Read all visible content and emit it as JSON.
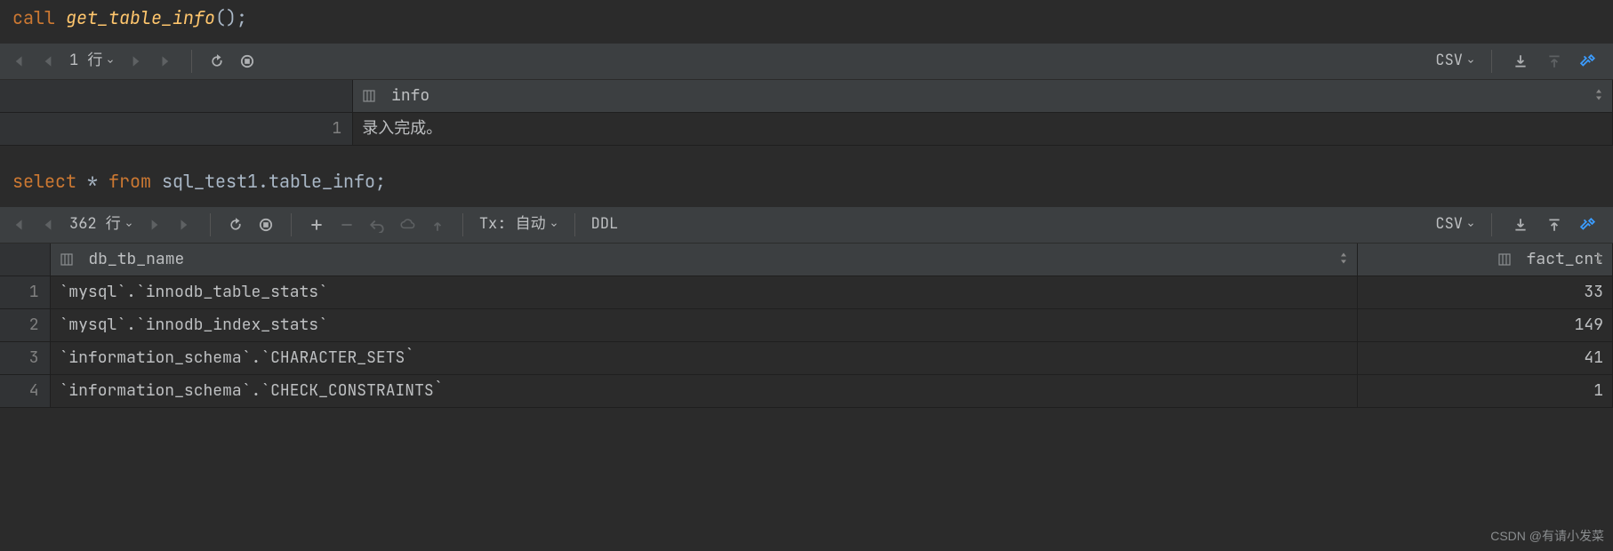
{
  "query1": {
    "sql_kw1": "call",
    "sql_fn": "get_table_info",
    "sql_tail": "();"
  },
  "toolbar1": {
    "rows_label": "1 行",
    "csv_label": "CSV"
  },
  "result1": {
    "col1_header": "info",
    "rows": [
      {
        "n": "1",
        "info": "录入完成。"
      }
    ]
  },
  "query2": {
    "sql_kw1": "select",
    "sql_star": "*",
    "sql_kw2": "from",
    "sql_ident": "sql_test1.table_info",
    "sql_tail": ";"
  },
  "toolbar2": {
    "rows_label": "362 行",
    "tx_label": "Tx: 自动",
    "ddl_label": "DDL",
    "csv_label": "CSV"
  },
  "result2": {
    "col1_header": "db_tb_name",
    "col2_header": "fact_cnt",
    "rows": [
      {
        "n": "1",
        "db_tb_name": "`mysql`.`innodb_table_stats`",
        "fact_cnt": "33"
      },
      {
        "n": "2",
        "db_tb_name": "`mysql`.`innodb_index_stats`",
        "fact_cnt": "149"
      },
      {
        "n": "3",
        "db_tb_name": "`information_schema`.`CHARACTER_SETS`",
        "fact_cnt": "41"
      },
      {
        "n": "4",
        "db_tb_name": "`information_schema`.`CHECK_CONSTRAINTS`",
        "fact_cnt": "1"
      }
    ]
  },
  "watermark": "CSDN @有请小发菜"
}
